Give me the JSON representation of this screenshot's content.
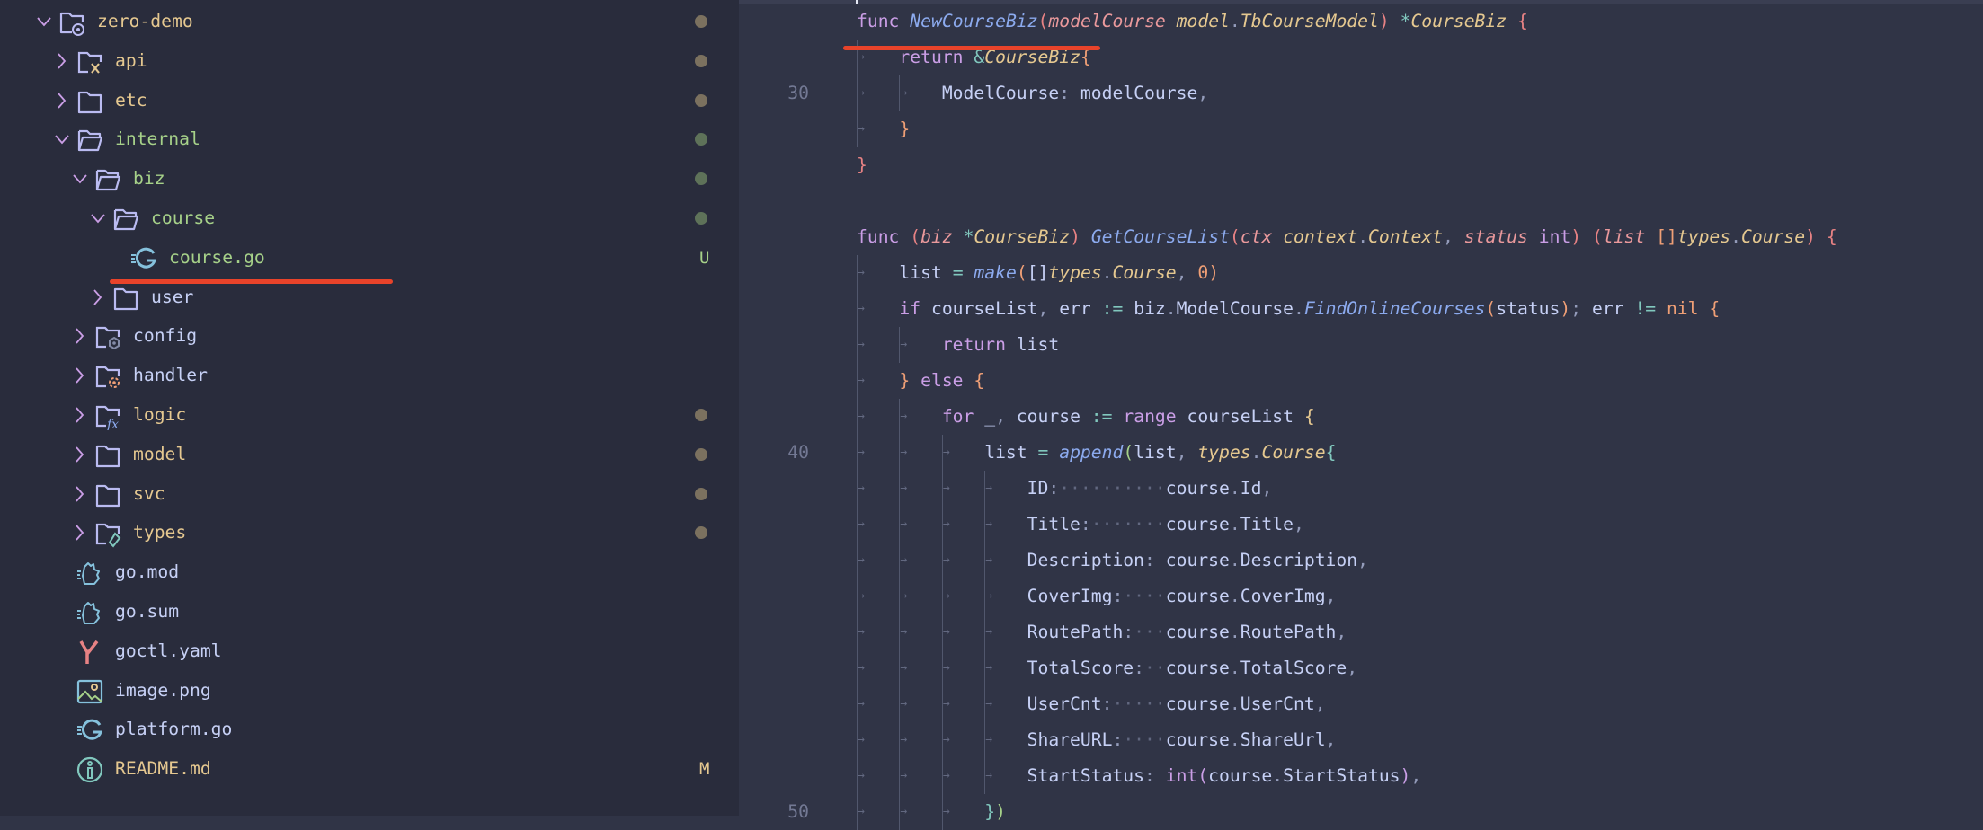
{
  "colors": {
    "modified": "#e5c890",
    "untracked": "#a6d189",
    "default": "#c6d0f5",
    "dot_modified": "#7b715f",
    "dot_untracked": "#5e7259",
    "annotation": "#e8432a"
  },
  "explorer": {
    "items": [
      {
        "label": "zero-demo",
        "level": 0,
        "kind": "folder",
        "expanded": true,
        "icon": "folder-root-icon",
        "status": "modified",
        "dot": true
      },
      {
        "label": "api",
        "level": 1,
        "kind": "folder",
        "expanded": false,
        "icon": "folder-api-icon",
        "status": "modified",
        "dot": true
      },
      {
        "label": "etc",
        "level": 1,
        "kind": "folder",
        "expanded": false,
        "icon": "folder-icon",
        "status": "modified",
        "dot": true
      },
      {
        "label": "internal",
        "level": 1,
        "kind": "folder",
        "expanded": true,
        "icon": "folder-open-icon",
        "status": "untracked",
        "dot": true
      },
      {
        "label": "biz",
        "level": 2,
        "kind": "folder",
        "expanded": true,
        "icon": "folder-open-icon",
        "status": "untracked",
        "dot": true
      },
      {
        "label": "course",
        "level": 3,
        "kind": "folder",
        "expanded": true,
        "icon": "folder-open-icon",
        "status": "untracked",
        "dot": true
      },
      {
        "label": "course.go",
        "level": 4,
        "kind": "file",
        "icon": "go-file-icon",
        "status": "untracked",
        "badge": "U"
      },
      {
        "label": "user",
        "level": 3,
        "kind": "folder",
        "expanded": false,
        "icon": "folder-icon",
        "status": "default"
      },
      {
        "label": "config",
        "level": 2,
        "kind": "folder",
        "expanded": false,
        "icon": "folder-config-icon",
        "status": "default"
      },
      {
        "label": "handler",
        "level": 2,
        "kind": "folder",
        "expanded": false,
        "icon": "folder-handler-icon",
        "status": "default"
      },
      {
        "label": "logic",
        "level": 2,
        "kind": "folder",
        "expanded": false,
        "icon": "folder-logic-icon",
        "status": "modified",
        "dot": true
      },
      {
        "label": "model",
        "level": 2,
        "kind": "folder",
        "expanded": false,
        "icon": "folder-icon",
        "status": "modified",
        "dot": true
      },
      {
        "label": "svc",
        "level": 2,
        "kind": "folder",
        "expanded": false,
        "icon": "folder-icon",
        "status": "modified",
        "dot": true
      },
      {
        "label": "types",
        "level": 2,
        "kind": "folder",
        "expanded": false,
        "icon": "folder-types-icon",
        "status": "modified",
        "dot": true
      },
      {
        "label": "go.mod",
        "level": 1,
        "kind": "file",
        "icon": "go-mod-icon",
        "status": "default"
      },
      {
        "label": "go.sum",
        "level": 1,
        "kind": "file",
        "icon": "go-mod-icon",
        "status": "default"
      },
      {
        "label": "goctl.yaml",
        "level": 1,
        "kind": "file",
        "icon": "yaml-icon",
        "status": "default"
      },
      {
        "label": "image.png",
        "level": 1,
        "kind": "file",
        "icon": "image-icon",
        "status": "default"
      },
      {
        "label": "platform.go",
        "level": 1,
        "kind": "file",
        "icon": "go-file-icon",
        "status": "default"
      },
      {
        "label": "README.md",
        "level": 1,
        "kind": "file",
        "icon": "info-icon",
        "status": "modified",
        "badge": "M"
      }
    ]
  },
  "editor": {
    "line_numbers": [
      {
        "line": 0,
        "number": "30",
        "index": 2
      },
      {
        "line": 1,
        "number": "40",
        "index": 12
      },
      {
        "line": 2,
        "number": "50",
        "index": 22
      }
    ],
    "lines": [
      {
        "indent": 0,
        "tokens": [
          [
            "func",
            "kw"
          ],
          [
            " ",
            "txt"
          ],
          [
            "NewCourseBiz",
            "fn"
          ],
          [
            "(",
            "br1"
          ],
          [
            "modelCourse",
            "param"
          ],
          [
            " ",
            "txt"
          ],
          [
            "model",
            "type"
          ],
          [
            ".",
            "punc"
          ],
          [
            "TbCourseModel",
            "type"
          ],
          [
            ")",
            "br1"
          ],
          [
            " ",
            "txt"
          ],
          [
            "*",
            "op"
          ],
          [
            "CourseBiz",
            "type"
          ],
          [
            " ",
            "txt"
          ],
          [
            "{",
            "br1"
          ]
        ]
      },
      {
        "indent": 1,
        "tokens": [
          [
            "return",
            "kw"
          ],
          [
            " ",
            "txt"
          ],
          [
            "&",
            "op"
          ],
          [
            "CourseBiz",
            "type"
          ],
          [
            "{",
            "br2"
          ]
        ]
      },
      {
        "indent": 2,
        "tokens": [
          [
            "ModelCourse",
            "txt"
          ],
          [
            ":",
            "punc"
          ],
          [
            " modelCourse",
            "txt"
          ],
          [
            ",",
            "punc"
          ]
        ]
      },
      {
        "indent": 1,
        "tokens": [
          [
            "}",
            "br2"
          ]
        ]
      },
      {
        "indent": 0,
        "tokens": [
          [
            "}",
            "br1"
          ]
        ]
      },
      {
        "indent": 0,
        "tokens": []
      },
      {
        "indent": 0,
        "tokens": [
          [
            "func",
            "kw"
          ],
          [
            " ",
            "txt"
          ],
          [
            "(",
            "br1"
          ],
          [
            "biz",
            "param"
          ],
          [
            " ",
            "txt"
          ],
          [
            "*",
            "op"
          ],
          [
            "CourseBiz",
            "type"
          ],
          [
            ")",
            "br1"
          ],
          [
            " ",
            "txt"
          ],
          [
            "GetCourseList",
            "fn"
          ],
          [
            "(",
            "br1"
          ],
          [
            "ctx",
            "param"
          ],
          [
            " ",
            "txt"
          ],
          [
            "context",
            "type"
          ],
          [
            ".",
            "punc"
          ],
          [
            "Context",
            "type"
          ],
          [
            ",",
            "punc"
          ],
          [
            " ",
            "txt"
          ],
          [
            "status",
            "param"
          ],
          [
            " ",
            "txt"
          ],
          [
            "int",
            "kw"
          ],
          [
            ")",
            "br1"
          ],
          [
            " ",
            "txt"
          ],
          [
            "(",
            "br1"
          ],
          [
            "list",
            "param"
          ],
          [
            " ",
            "txt"
          ],
          [
            "[]",
            "br2"
          ],
          [
            "types",
            "type"
          ],
          [
            ".",
            "punc"
          ],
          [
            "Course",
            "type"
          ],
          [
            ")",
            "br1"
          ],
          [
            " ",
            "txt"
          ],
          [
            "{",
            "br1"
          ]
        ]
      },
      {
        "indent": 1,
        "tokens": [
          [
            "list",
            "txt"
          ],
          [
            " ",
            "txt"
          ],
          [
            "=",
            "op"
          ],
          [
            " ",
            "txt"
          ],
          [
            "make",
            "fn"
          ],
          [
            "(",
            "br2"
          ],
          [
            "[]",
            "txt"
          ],
          [
            "types",
            "type"
          ],
          [
            ".",
            "punc"
          ],
          [
            "Course",
            "type"
          ],
          [
            ",",
            "punc"
          ],
          [
            " ",
            "txt"
          ],
          [
            "0",
            "num"
          ],
          [
            ")",
            "br2"
          ]
        ]
      },
      {
        "indent": 1,
        "tokens": [
          [
            "if",
            "kw"
          ],
          [
            " courseList",
            "txt"
          ],
          [
            ",",
            "punc"
          ],
          [
            " err ",
            "txt"
          ],
          [
            ":=",
            "op"
          ],
          [
            " biz",
            "txt"
          ],
          [
            ".",
            "punc"
          ],
          [
            "ModelCourse",
            "txt"
          ],
          [
            ".",
            "punc"
          ],
          [
            "FindOnlineCourses",
            "fn"
          ],
          [
            "(",
            "br2"
          ],
          [
            "status",
            "txt"
          ],
          [
            ")",
            "br2"
          ],
          [
            ";",
            "punc"
          ],
          [
            " err ",
            "txt"
          ],
          [
            "!=",
            "op"
          ],
          [
            " ",
            "txt"
          ],
          [
            "nil",
            "num"
          ],
          [
            " ",
            "txt"
          ],
          [
            "{",
            "br2"
          ]
        ]
      },
      {
        "indent": 2,
        "tokens": [
          [
            "return",
            "kw"
          ],
          [
            " list",
            "txt"
          ]
        ]
      },
      {
        "indent": 1,
        "tokens": [
          [
            "}",
            "br2"
          ],
          [
            " ",
            "txt"
          ],
          [
            "else",
            "kw"
          ],
          [
            " ",
            "txt"
          ],
          [
            "{",
            "br2"
          ]
        ]
      },
      {
        "indent": 2,
        "tokens": [
          [
            "for",
            "kw"
          ],
          [
            " _",
            "txt"
          ],
          [
            ",",
            "punc"
          ],
          [
            " course ",
            "txt"
          ],
          [
            ":=",
            "op"
          ],
          [
            " ",
            "txt"
          ],
          [
            "range",
            "kw"
          ],
          [
            " courseList ",
            "txt"
          ],
          [
            "{",
            "br3"
          ]
        ]
      },
      {
        "indent": 3,
        "tokens": [
          [
            "list",
            "txt"
          ],
          [
            " ",
            "txt"
          ],
          [
            "=",
            "op"
          ],
          [
            " ",
            "txt"
          ],
          [
            "append",
            "fn"
          ],
          [
            "(",
            "br4"
          ],
          [
            "list",
            "txt"
          ],
          [
            ",",
            "punc"
          ],
          [
            " ",
            "txt"
          ],
          [
            "types",
            "type"
          ],
          [
            ".",
            "punc"
          ],
          [
            "Course",
            "type"
          ],
          [
            "{",
            "br5"
          ]
        ]
      },
      {
        "indent": 4,
        "tokens": [
          [
            "ID",
            "txt"
          ],
          [
            ":",
            "punc"
          ],
          [
            "··········",
            "ws"
          ],
          [
            "course",
            "txt"
          ],
          [
            ".",
            "punc"
          ],
          [
            "Id",
            "txt"
          ],
          [
            ",",
            "punc"
          ]
        ]
      },
      {
        "indent": 4,
        "tokens": [
          [
            "Title",
            "txt"
          ],
          [
            ":",
            "punc"
          ],
          [
            "·······",
            "ws"
          ],
          [
            "course",
            "txt"
          ],
          [
            ".",
            "punc"
          ],
          [
            "Title",
            "txt"
          ],
          [
            ",",
            "punc"
          ]
        ]
      },
      {
        "indent": 4,
        "tokens": [
          [
            "Description",
            "txt"
          ],
          [
            ":",
            "punc"
          ],
          [
            " ",
            "txt"
          ],
          [
            "course",
            "txt"
          ],
          [
            ".",
            "punc"
          ],
          [
            "Description",
            "txt"
          ],
          [
            ",",
            "punc"
          ]
        ]
      },
      {
        "indent": 4,
        "tokens": [
          [
            "CoverImg",
            "txt"
          ],
          [
            ":",
            "punc"
          ],
          [
            "····",
            "ws"
          ],
          [
            "course",
            "txt"
          ],
          [
            ".",
            "punc"
          ],
          [
            "CoverImg",
            "txt"
          ],
          [
            ",",
            "punc"
          ]
        ]
      },
      {
        "indent": 4,
        "tokens": [
          [
            "RoutePath",
            "txt"
          ],
          [
            ":",
            "punc"
          ],
          [
            "···",
            "ws"
          ],
          [
            "course",
            "txt"
          ],
          [
            ".",
            "punc"
          ],
          [
            "RoutePath",
            "txt"
          ],
          [
            ",",
            "punc"
          ]
        ]
      },
      {
        "indent": 4,
        "tokens": [
          [
            "TotalScore",
            "txt"
          ],
          [
            ":",
            "punc"
          ],
          [
            "··",
            "ws"
          ],
          [
            "course",
            "txt"
          ],
          [
            ".",
            "punc"
          ],
          [
            "TotalScore",
            "txt"
          ],
          [
            ",",
            "punc"
          ]
        ]
      },
      {
        "indent": 4,
        "tokens": [
          [
            "UserCnt",
            "txt"
          ],
          [
            ":",
            "punc"
          ],
          [
            "·····",
            "ws"
          ],
          [
            "course",
            "txt"
          ],
          [
            ".",
            "punc"
          ],
          [
            "UserCnt",
            "txt"
          ],
          [
            ",",
            "punc"
          ]
        ]
      },
      {
        "indent": 4,
        "tokens": [
          [
            "ShareURL",
            "txt"
          ],
          [
            ":",
            "punc"
          ],
          [
            "····",
            "ws"
          ],
          [
            "course",
            "txt"
          ],
          [
            ".",
            "punc"
          ],
          [
            "ShareUrl",
            "txt"
          ],
          [
            ",",
            "punc"
          ]
        ]
      },
      {
        "indent": 4,
        "tokens": [
          [
            "StartStatus",
            "txt"
          ],
          [
            ":",
            "punc"
          ],
          [
            " ",
            "txt"
          ],
          [
            "int",
            "kw"
          ],
          [
            "(",
            "bi"
          ],
          [
            "course",
            "txt"
          ],
          [
            ".",
            "punc"
          ],
          [
            "StartStatus",
            "txt"
          ],
          [
            ")",
            "bi"
          ],
          [
            ",",
            "punc"
          ]
        ]
      },
      {
        "indent": 3,
        "tokens": [
          [
            "}",
            "br5"
          ],
          [
            ")",
            "br4"
          ]
        ]
      }
    ]
  }
}
